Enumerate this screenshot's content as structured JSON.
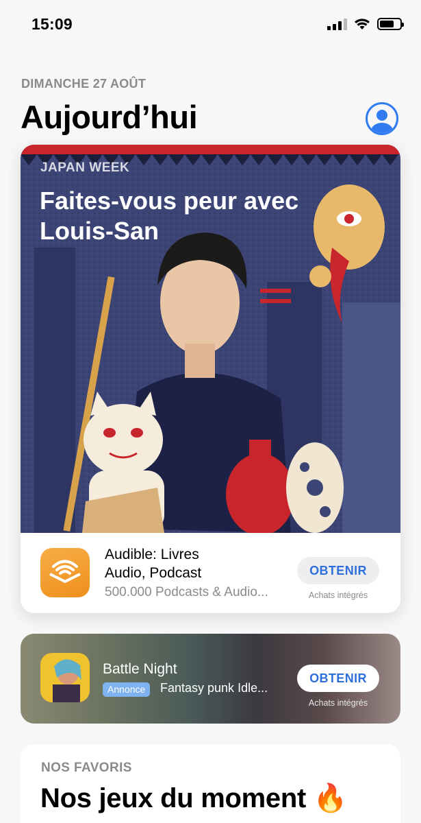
{
  "status_bar": {
    "time": "15:09"
  },
  "header": {
    "date": "DIMANCHE 27 AOÛT",
    "title": "Aujourd’hui"
  },
  "feature_card": {
    "eyebrow": "JAPAN WEEK",
    "title": "Faites-vous peur avec Louis-San",
    "app": {
      "name": "Audible: Livres Audio, Podcast",
      "subtitle": "500.000 Podcasts & Audio...",
      "button_label": "OBTENIR",
      "iap_note": "Achats intégrés"
    }
  },
  "ad_card": {
    "name": "Battle Night",
    "badge": "Annonce",
    "description": "Fantasy punk Idle...",
    "button_label": "OBTENIR",
    "iap_note": "Achats intégrés"
  },
  "favorites_card": {
    "eyebrow": "NOS FAVORIS",
    "title": "Nos jeux du moment 🔥"
  },
  "colors": {
    "accent": "#2f7bef",
    "button_text": "#2f6fdb",
    "card_bg_dark": "#3c4575",
    "ad_badge": "#7fb3ef"
  }
}
